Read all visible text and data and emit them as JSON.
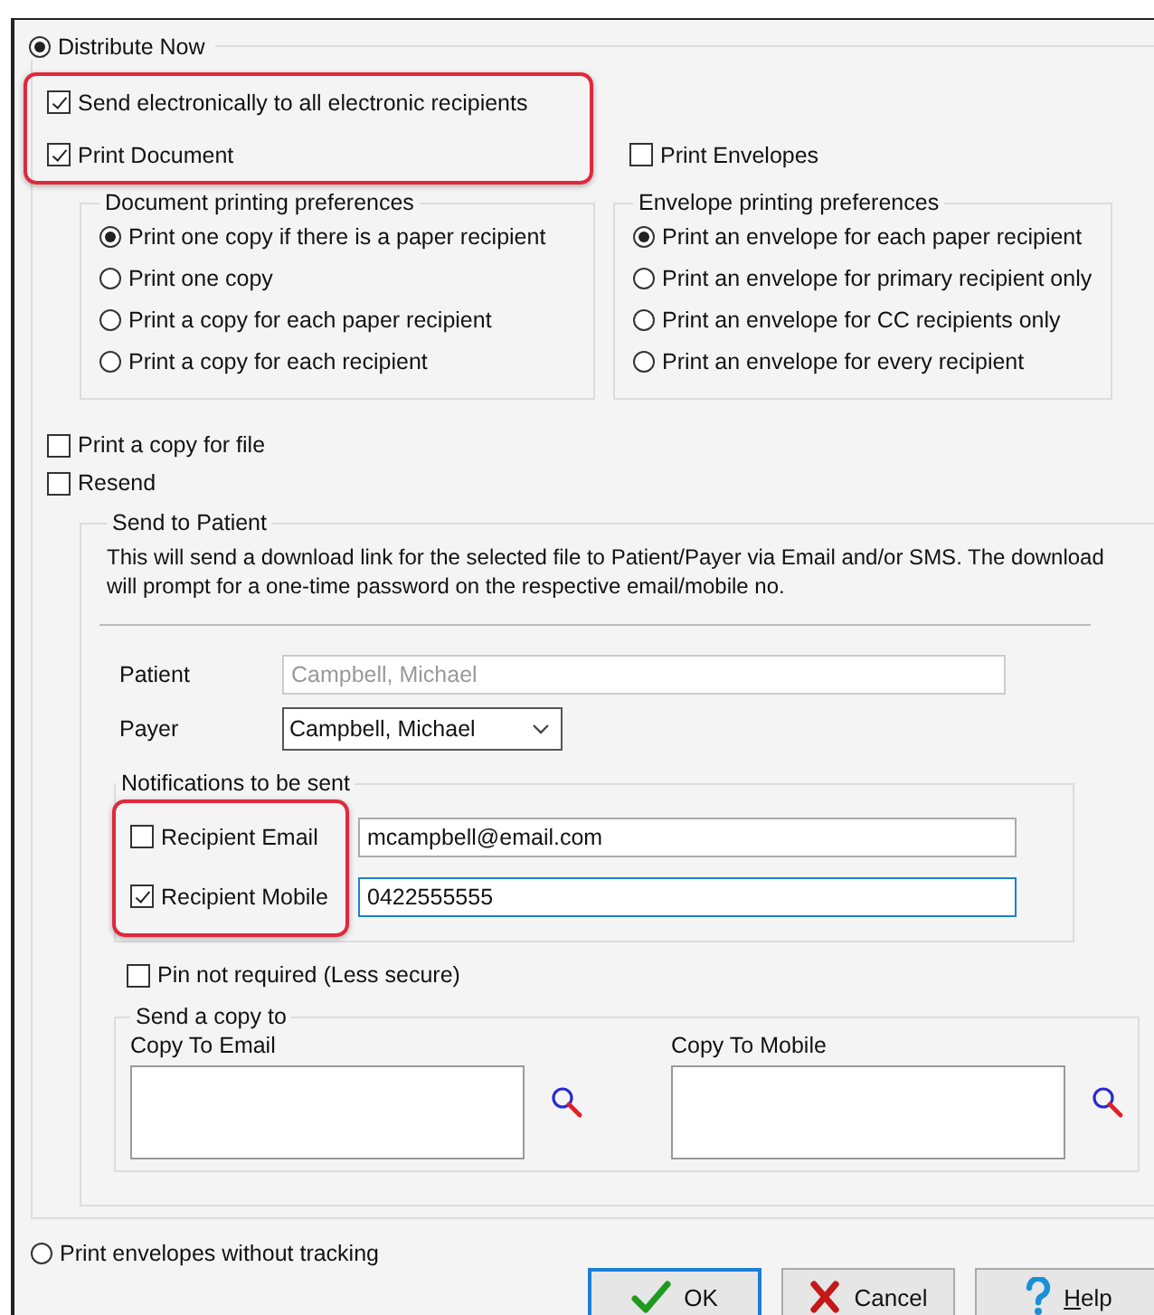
{
  "distribute_now": {
    "label": "Distribute Now",
    "selected": true
  },
  "send_electronically": {
    "label": "Send electronically to all electronic recipients",
    "checked": true
  },
  "print_document": {
    "label": "Print Document",
    "checked": true
  },
  "print_envelopes": {
    "label": "Print Envelopes",
    "checked": false
  },
  "document_preferences": {
    "title": "Document printing preferences",
    "options": [
      {
        "label": "Print one copy if there is a paper recipient",
        "selected": true
      },
      {
        "label": "Print one copy",
        "selected": false
      },
      {
        "label": "Print a copy for each paper recipient",
        "selected": false
      },
      {
        "label": "Print a copy for each recipient",
        "selected": false
      }
    ]
  },
  "envelope_preferences": {
    "title": "Envelope printing preferences",
    "options": [
      {
        "label": "Print an envelope for each paper recipient",
        "selected": true
      },
      {
        "label": "Print an envelope for primary recipient only",
        "selected": false
      },
      {
        "label": "Print an envelope for CC recipients only",
        "selected": false
      },
      {
        "label": "Print an envelope for every recipient",
        "selected": false
      }
    ]
  },
  "print_copy_for_file": {
    "label": "Print a copy for file",
    "checked": false
  },
  "resend": {
    "label": "Resend",
    "checked": false
  },
  "send_to_patient": {
    "title": "Send to Patient",
    "description": "This will send a download link for the selected file to Patient/Payer via Email and/or SMS. The download will prompt for a one-time password on the respective email/mobile no.",
    "patient": {
      "label": "Patient",
      "value": "Campbell, Michael",
      "disabled": true
    },
    "payer": {
      "label": "Payer",
      "value": "Campbell, Michael"
    },
    "notifications": {
      "title": "Notifications to be sent",
      "items": [
        {
          "label": "Recipient Email",
          "checked": false,
          "value": "mcampbell@email.com",
          "focused": false
        },
        {
          "label": "Recipient Mobile",
          "checked": true,
          "value": "0422555555",
          "focused": true
        }
      ]
    },
    "pin_not_required": {
      "label": "Pin not required (Less secure)",
      "checked": false
    },
    "send_copy": {
      "title": "Send a copy to",
      "fields": [
        {
          "label": "Copy To Email"
        },
        {
          "label": "Copy To Mobile"
        }
      ]
    }
  },
  "print_without_tracking": {
    "label": "Print envelopes without tracking",
    "selected": false
  },
  "buttons": [
    {
      "kind": "ok",
      "label": "OK"
    },
    {
      "kind": "cancel",
      "label": "Cancel"
    },
    {
      "kind": "help",
      "label": "Help"
    }
  ]
}
